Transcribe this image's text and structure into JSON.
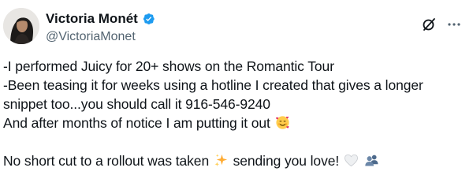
{
  "tweet": {
    "author": {
      "display_name": "Victoria Monét",
      "handle": "@VictoriaMonet",
      "verified": true,
      "verified_color": "#1d9bf0"
    },
    "icons": {
      "grok": "grok-icon",
      "more": "more-icon"
    },
    "body": {
      "line1": "-I performed Juicy for 20+ shows on the Romantic Tour",
      "line2": " -Been teasing it for weeks using a hotline I created that gives a longer",
      "line3": "snippet too...you should call it  916-546-9240",
      "line4": "And after months of notice I am putting it out",
      "line4_emoji": "smiling-face-with-hearts",
      "line5_part1": "No short cut to a rollout was taken",
      "line5_emoji1": "sparkles",
      "line5_part2": " sending you love!",
      "line5_emoji2": "white-heart",
      "line5_emoji3": "busts-in-silhouette"
    }
  }
}
